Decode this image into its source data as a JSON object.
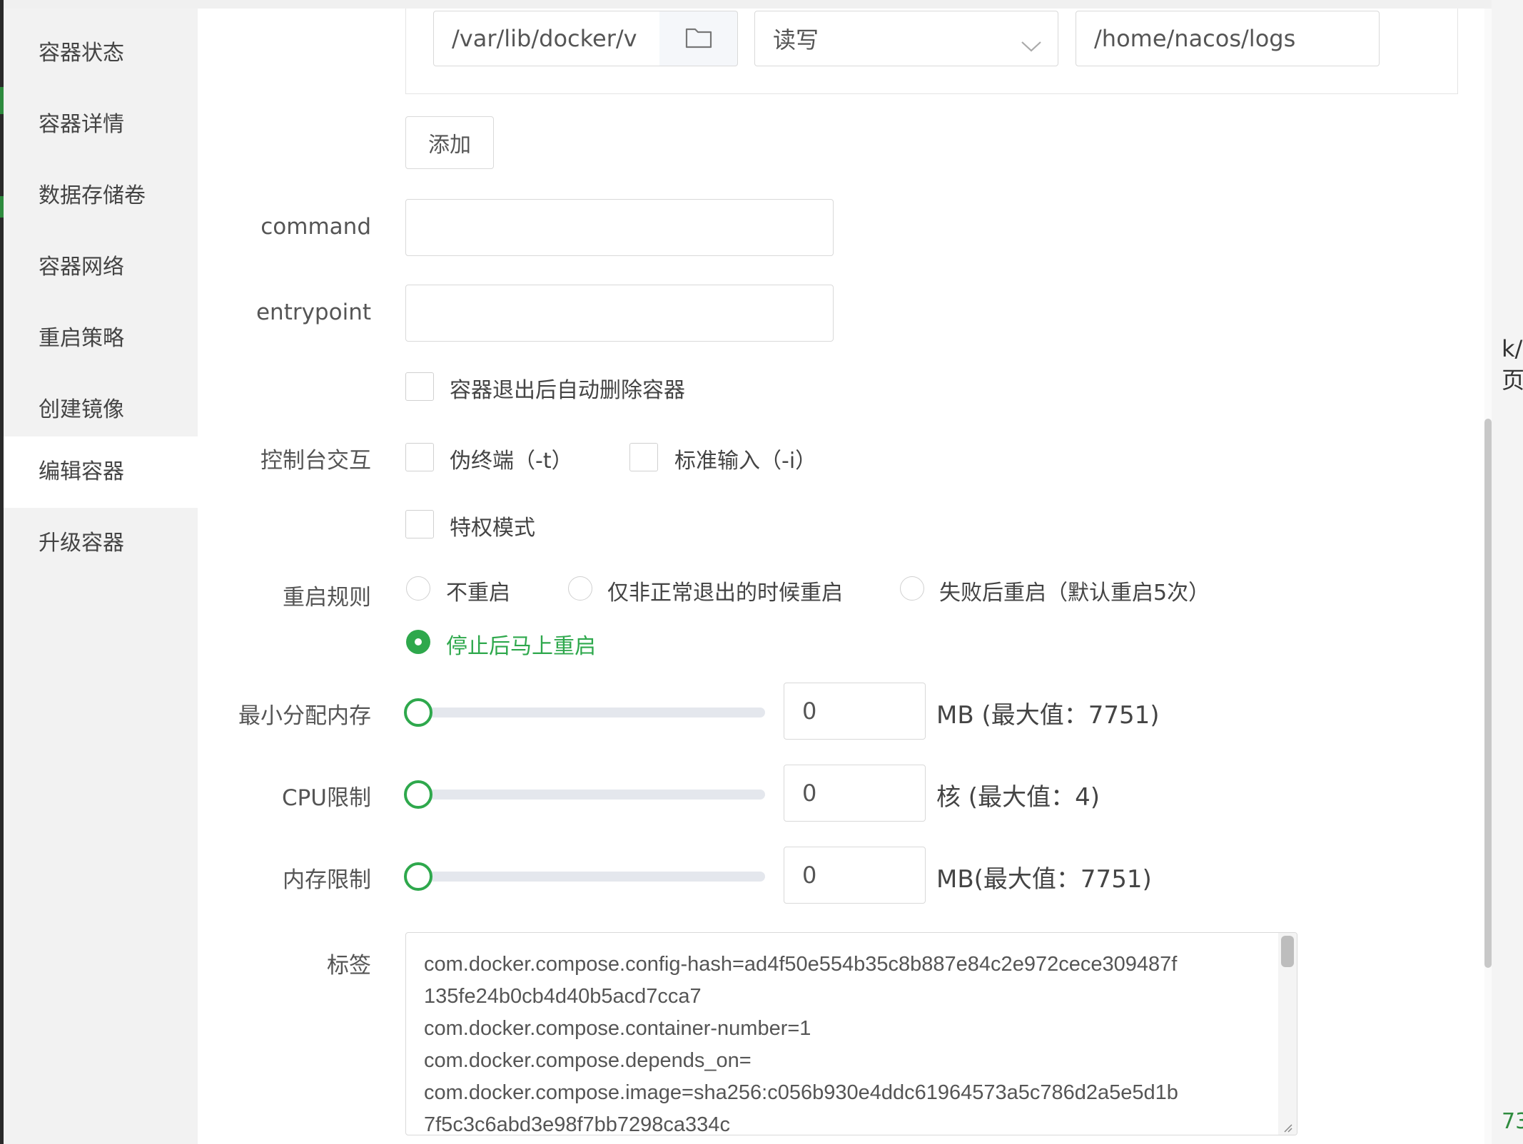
{
  "sidebar": {
    "items": [
      {
        "label": "容器状态",
        "active": false
      },
      {
        "label": "容器详情",
        "active": false
      },
      {
        "label": "数据存储卷",
        "active": false
      },
      {
        "label": "容器网络",
        "active": false
      },
      {
        "label": "重启策略",
        "active": false
      },
      {
        "label": "创建镜像",
        "active": false
      },
      {
        "label": "编辑容器",
        "active": true
      },
      {
        "label": "升级容器",
        "active": false
      }
    ]
  },
  "volume": {
    "host_path": "/var/lib/docker/v",
    "mode": "读写",
    "container_path": "/home/nacos/logs",
    "add_label": "添加"
  },
  "command": {
    "label": "command",
    "value": ""
  },
  "entrypoint": {
    "label": "entrypoint",
    "value": ""
  },
  "auto_remove": {
    "label": "容器退出后自动删除容器",
    "checked": false
  },
  "console": {
    "label": "控制台交互",
    "tty_label": "伪终端（-t）",
    "tty_checked": false,
    "stdin_label": "标准输入（-i）",
    "stdin_checked": false
  },
  "privileged": {
    "label": "特权模式",
    "checked": false
  },
  "restart": {
    "label": "重启规则",
    "options": [
      "不重启",
      "仅非正常退出的时候重启",
      "失败后重启（默认重启5次）",
      "停止后马上重启"
    ],
    "selected": "停止后马上重启"
  },
  "min_memory": {
    "label": "最小分配内存",
    "value": "0",
    "unit": "MB (最大值：7751)",
    "max": 7751
  },
  "cpu_limit": {
    "label": "CPU限制",
    "value": "0",
    "unit": "核 (最大值：4)",
    "max": 4
  },
  "mem_limit": {
    "label": "内存限制",
    "value": "0",
    "unit": "MB(最大值：7751)",
    "max": 7751
  },
  "labels": {
    "label": "标签",
    "lines": [
      "com.docker.compose.config-hash=ad4f50e554b35c8b887e84c2e972cece309487f",
      "135fe24b0cb4d40b5acd7cca7",
      "com.docker.compose.container-number=1",
      "com.docker.compose.depends_on=",
      "com.docker.compose.image=sha256:c056b930e4ddc61964573a5c786d2a5e5d1b",
      "7f5c3c6abd3e98f7bb7298ca334c"
    ]
  },
  "backdrop": {
    "right_fragment": "k/页",
    "bottom_fragment": "73"
  },
  "colors": {
    "accent": "#2ea84c",
    "sidebar_bg": "#f2f2f2"
  }
}
